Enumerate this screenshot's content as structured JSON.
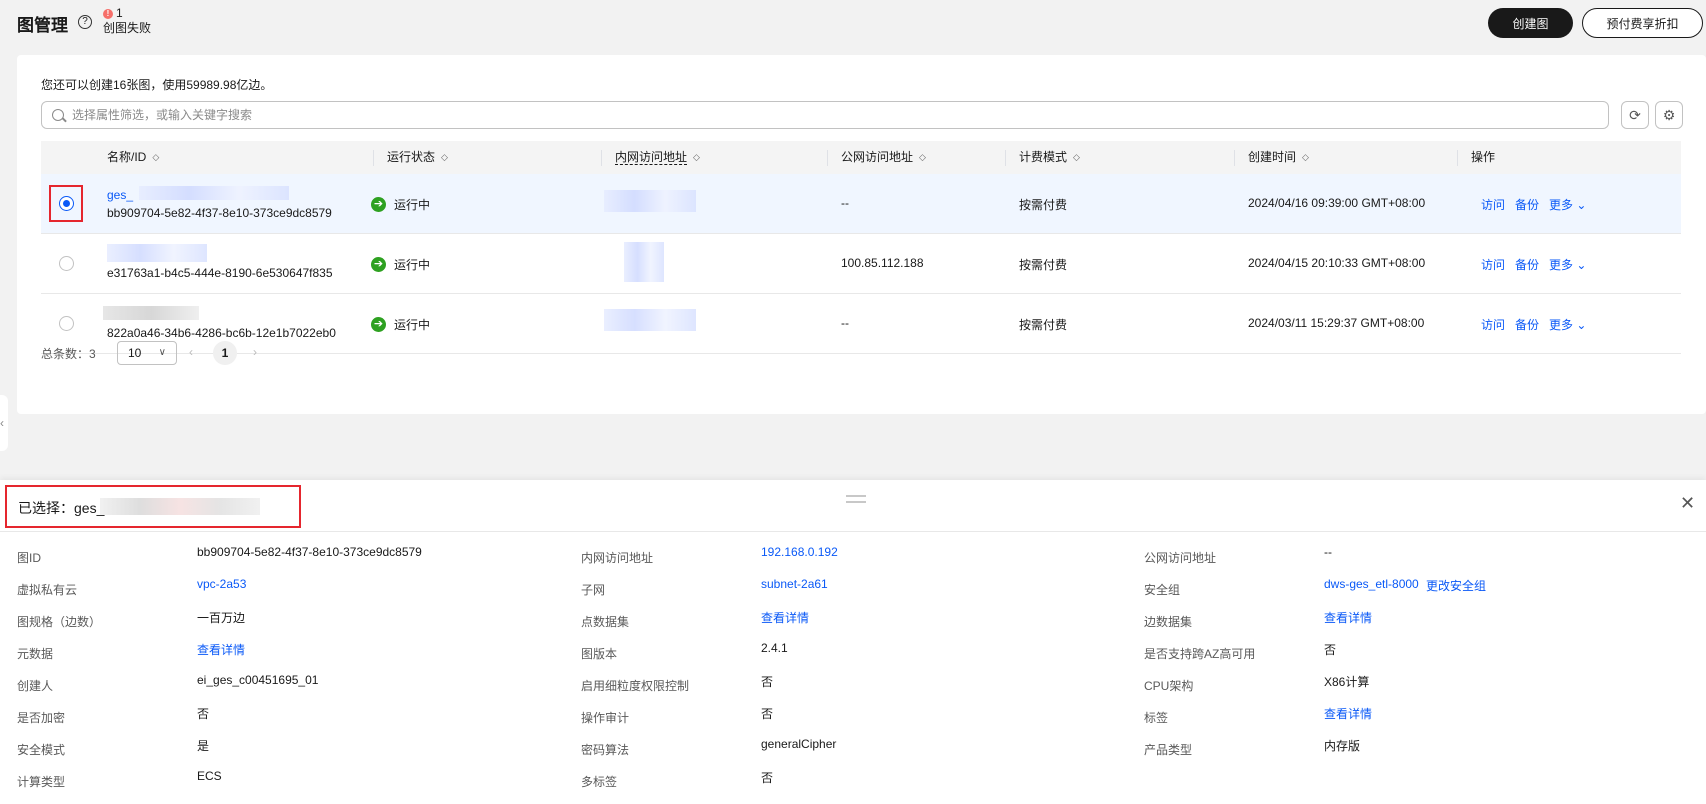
{
  "header": {
    "title": "图管理",
    "help_icon": "?",
    "fail_count": "1",
    "fail_label": "创图失败",
    "create_button": "创建图",
    "prepaid_button": "预付费享折扣"
  },
  "toolbar": {
    "quota_text": "您还可以创建16张图，使用59989.98亿边。",
    "search_placeholder": "选择属性筛选，或输入关键字搜索",
    "refresh_icon": "⟳",
    "settings_icon": "⚙"
  },
  "table": {
    "columns": [
      "名称/ID",
      "运行状态",
      "内网访问地址",
      "公网访问地址",
      "计费模式",
      "创建时间",
      "操作"
    ],
    "rows": [
      {
        "name": "ges_",
        "id": "bb909704-5e82-4f37-8e10-373ce9dc8579",
        "status": "运行中",
        "public_ip": "--",
        "billing": "按需付费",
        "created": "2024/04/16 09:39:00 GMT+08:00",
        "ops": [
          "访问",
          "备份",
          "更多"
        ],
        "selected": true
      },
      {
        "name": "",
        "id": "e31763a1-b4c5-444e-8190-6e530647f835",
        "status": "运行中",
        "public_ip": "100.85.112.188",
        "billing": "按需付费",
        "created": "2024/04/15 20:10:33 GMT+08:00",
        "ops": [
          "访问",
          "备份",
          "更多"
        ],
        "selected": false
      },
      {
        "name": "",
        "id": "822a0a46-34b6-4286-bc6b-12e1b7022eb0",
        "status": "运行中",
        "public_ip": "--",
        "billing": "按需付费",
        "created": "2024/03/11 15:29:37 GMT+08:00",
        "ops": [
          "访问",
          "备份",
          "更多"
        ],
        "selected": false
      }
    ]
  },
  "pagination": {
    "total_label": "总条数：3",
    "page_size": "10",
    "current_page": "1"
  },
  "detail": {
    "selected_label": "已选择：ges_",
    "fields": [
      {
        "label": "图ID",
        "value": "bb909704-5e82-4f37-8e10-373ce9dc8579",
        "link": false
      },
      {
        "label": "虚拟私有云",
        "value": "vpc-2a53",
        "link": true
      },
      {
        "label": "图规格（边数）",
        "value": "一百万边",
        "link": false
      },
      {
        "label": "元数据",
        "value": "查看详情",
        "link": true
      },
      {
        "label": "创建人",
        "value": "ei_ges_c00451695_01",
        "link": false
      },
      {
        "label": "是否加密",
        "value": "否",
        "link": false
      },
      {
        "label": "安全模式",
        "value": "是",
        "link": false
      },
      {
        "label": "计算类型",
        "value": "ECS",
        "link": false
      },
      {
        "label": "内网访问地址",
        "value": "192.168.0.192",
        "link": true
      },
      {
        "label": "子网",
        "value": "subnet-2a61",
        "link": true
      },
      {
        "label": "点数据集",
        "value": "查看详情",
        "link": true
      },
      {
        "label": "图版本",
        "value": "2.4.1",
        "link": false
      },
      {
        "label": "启用细粒度权限控制",
        "value": "否",
        "link": false
      },
      {
        "label": "操作审计",
        "value": "否",
        "link": false
      },
      {
        "label": "密码算法",
        "value": "generalCipher",
        "link": false
      },
      {
        "label": "多标签",
        "value": "否",
        "link": false
      },
      {
        "label": "公网访问地址",
        "value": "--",
        "link": false
      },
      {
        "label": "安全组",
        "value": "dws-ges_etl-8000",
        "link": true,
        "extra": "更改安全组"
      },
      {
        "label": "边数据集",
        "value": "查看详情",
        "link": true
      },
      {
        "label": "是否支持跨AZ高可用",
        "value": "否",
        "link": false
      },
      {
        "label": "CPU架构",
        "value": "X86计算",
        "link": false
      },
      {
        "label": "标签",
        "value": "查看详情",
        "link": true
      },
      {
        "label": "产品类型",
        "value": "内存版",
        "link": false
      }
    ]
  },
  "colors": {
    "accent": "#0a59f7",
    "running": "#2ea121",
    "highlight": "#e5262e",
    "selected_row": "#f0f6ff"
  }
}
